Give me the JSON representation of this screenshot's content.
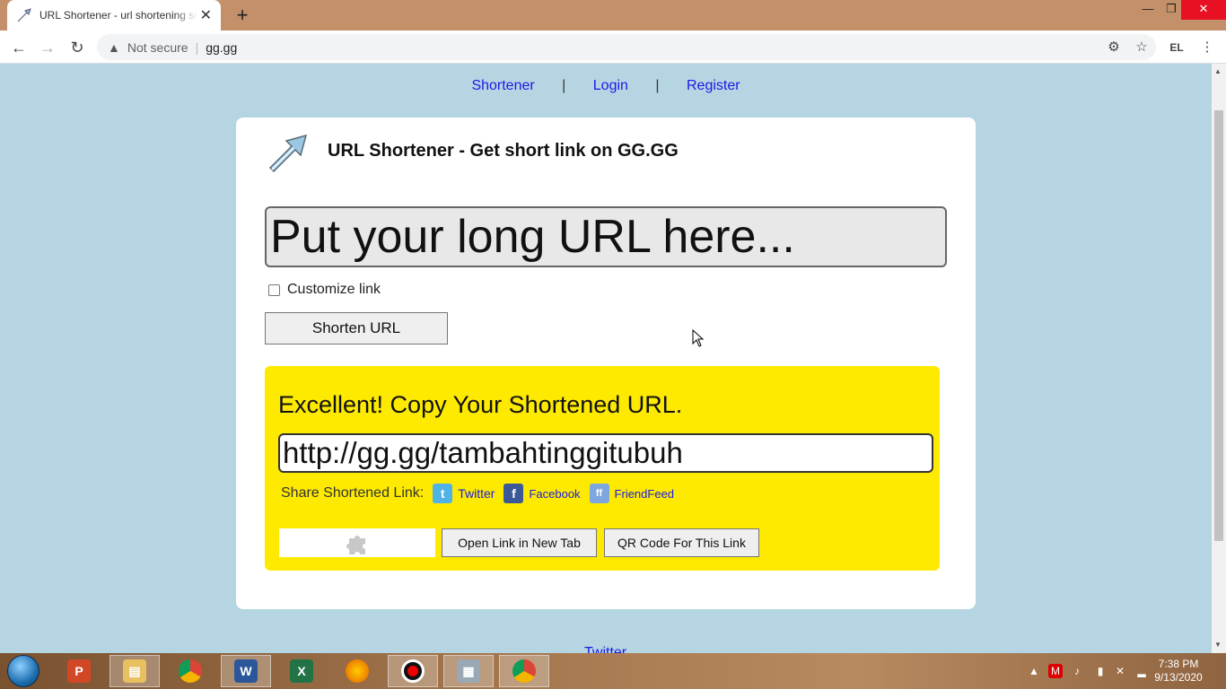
{
  "browser": {
    "tab_title": "URL Shortener - url shortening service",
    "tab_close": "✕",
    "new_tab": "+",
    "security_label": "Not secure",
    "address": "gg.gg",
    "window_controls": {
      "minimize": "—",
      "maximize": "❐",
      "close": "✕"
    }
  },
  "nav": {
    "shortener": "Shortener",
    "login": "Login",
    "register": "Register",
    "separator": "|"
  },
  "card": {
    "title": "URL Shortener - Get short link on GG.GG",
    "long_url_placeholder": "Put your long URL here...",
    "customize_label": "Customize link",
    "shorten_button": "Shorten URL"
  },
  "result": {
    "heading": "Excellent! Copy Your Shortened URL.",
    "short_url": "http://gg.gg/tambahtinggitubuh",
    "share_label": "Share Shortened Link:",
    "share_twitter": "Twitter",
    "share_facebook": "Facebook",
    "share_friendfeed": "FriendFeed",
    "open_new_tab_button": "Open Link in New Tab",
    "qr_button": "QR Code For This Link"
  },
  "footer": {
    "twitter": "Twitter"
  },
  "taskbar": {
    "time": "7:38 PM",
    "date": "9/13/2020"
  },
  "colors": {
    "page_bg": "#b5d5e2",
    "result_bg": "#fdea00",
    "link": "#1a1ae6",
    "titlebar": "#c3906a"
  }
}
